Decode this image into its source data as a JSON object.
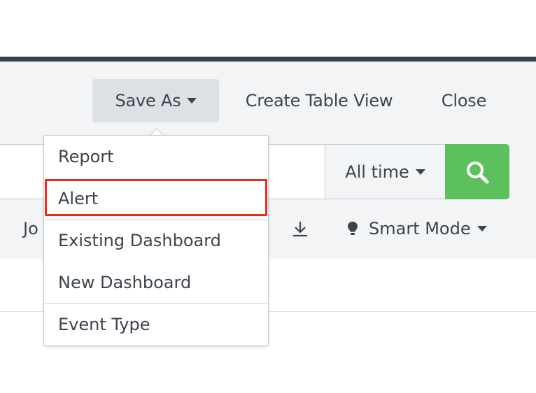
{
  "actions": {
    "save_as": "Save As",
    "create_table_view": "Create Table View",
    "close": "Close"
  },
  "search": {
    "time_range": "All time"
  },
  "toolbar": {
    "job_label_partial": "Jo",
    "smart_mode": "Smart Mode"
  },
  "save_as_menu": {
    "items": [
      {
        "label": "Report"
      },
      {
        "label": "Alert",
        "highlighted": true
      },
      {
        "label": "Existing Dashboard"
      },
      {
        "label": "New Dashboard"
      },
      {
        "label": "Event Type"
      }
    ]
  },
  "colors": {
    "search_button": "#5cc05c",
    "highlight": "#ee2a18",
    "text": "#3c444d",
    "band": "#f2f4f5"
  },
  "icons": {
    "search": "search-icon",
    "download": "download-icon",
    "smart_mode": "bulb-icon",
    "caret": "caret-down-icon"
  }
}
